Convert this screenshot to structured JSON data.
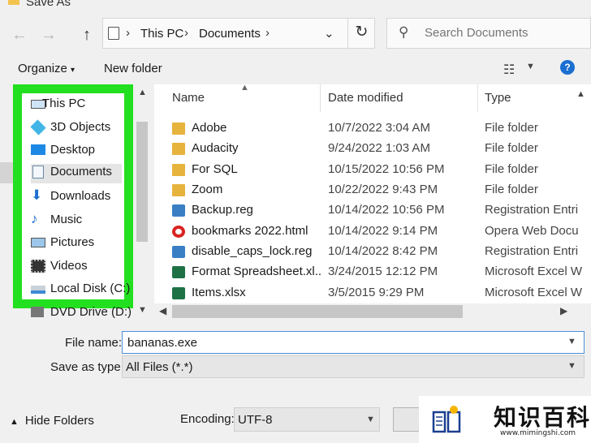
{
  "window": {
    "title": "Save As"
  },
  "address": {
    "segments": [
      "This PC",
      "Documents"
    ]
  },
  "search": {
    "placeholder": "Search Documents"
  },
  "toolbar": {
    "organize_label": "Organize",
    "new_folder_label": "New folder",
    "help_label": "?"
  },
  "nav": {
    "items": [
      {
        "label": "This PC",
        "icon": "computer-icon"
      },
      {
        "label": "3D Objects",
        "icon": "cube-icon"
      },
      {
        "label": "Desktop",
        "icon": "desktop-icon"
      },
      {
        "label": "Documents",
        "icon": "document-icon",
        "selected": true
      },
      {
        "label": "Downloads",
        "icon": "download-arrow-icon"
      },
      {
        "label": "Music",
        "icon": "music-note-icon"
      },
      {
        "label": "Pictures",
        "icon": "pictures-icon"
      },
      {
        "label": "Videos",
        "icon": "film-icon"
      },
      {
        "label": "Local Disk (C:)",
        "icon": "drive-icon"
      }
    ],
    "partial_item": "DVD Drive (D:) W"
  },
  "columns": {
    "name": "Name",
    "date": "Date modified",
    "type": "Type"
  },
  "files": [
    {
      "name": "Adobe",
      "date": "10/7/2022 3:04 AM",
      "type": "File folder",
      "icon": "folder-icon"
    },
    {
      "name": "Audacity",
      "date": "9/24/2022 1:03 AM",
      "type": "File folder",
      "icon": "folder-icon"
    },
    {
      "name": "For SQL",
      "date": "10/15/2022 10:56 PM",
      "type": "File folder",
      "icon": "folder-icon"
    },
    {
      "name": "Zoom",
      "date": "10/22/2022 9:43 PM",
      "type": "File folder",
      "icon": "folder-icon"
    },
    {
      "name": "Backup.reg",
      "date": "10/14/2022 10:56 PM",
      "type": "Registration Entri",
      "icon": "registry-icon"
    },
    {
      "name": "bookmarks 2022.html",
      "date": "10/14/2022 9:14 PM",
      "type": "Opera Web Docu",
      "icon": "opera-icon"
    },
    {
      "name": "disable_caps_lock.reg",
      "date": "10/14/2022 8:42 PM",
      "type": "Registration Entri",
      "icon": "registry-icon"
    },
    {
      "name": "Format Spreadsheet.xl...",
      "date": "3/24/2015 12:12 PM",
      "type": "Microsoft Excel W",
      "icon": "excel-icon"
    },
    {
      "name": "Items.xlsx",
      "date": "3/5/2015 9:29 PM",
      "type": "Microsoft Excel W",
      "icon": "excel-icon"
    }
  ],
  "form": {
    "file_name_label": "File name:",
    "file_name_value": "bananas.exe",
    "save_type_label": "Save as type:",
    "save_type_value": "All Files  (*.*)",
    "encoding_label": "Encoding:",
    "encoding_value": "UTF-8",
    "hide_folders_label": "Hide Folders"
  },
  "watermark": {
    "text": "知识百科",
    "url": "www.mimingshi.com"
  },
  "colors": {
    "highlight": "#22e01f",
    "accent": "#1a6fd1"
  }
}
